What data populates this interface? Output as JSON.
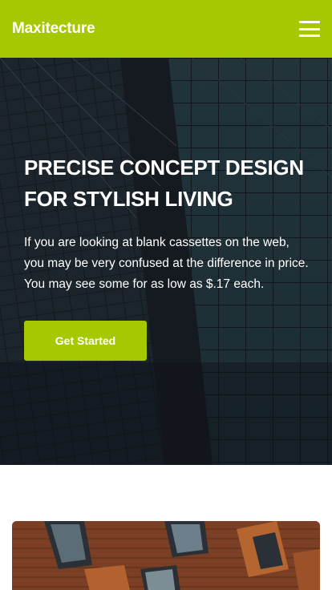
{
  "nav": {
    "brand": "Maxitecture",
    "menu_icon": "hamburger-menu-icon"
  },
  "hero": {
    "title_line1": "PRECISE CONCEPT DESIGN",
    "title_line2": "FOR STYLISH LIVING",
    "body": "If you are looking at blank cassettes on the web, you may be very confused at the difference in price. You may see some for as low as $.17 each.",
    "cta_label": "Get Started"
  },
  "colors": {
    "accent": "#a6c800",
    "hero_dark": "#232a31",
    "facade_wood": "#8a4a2c"
  }
}
